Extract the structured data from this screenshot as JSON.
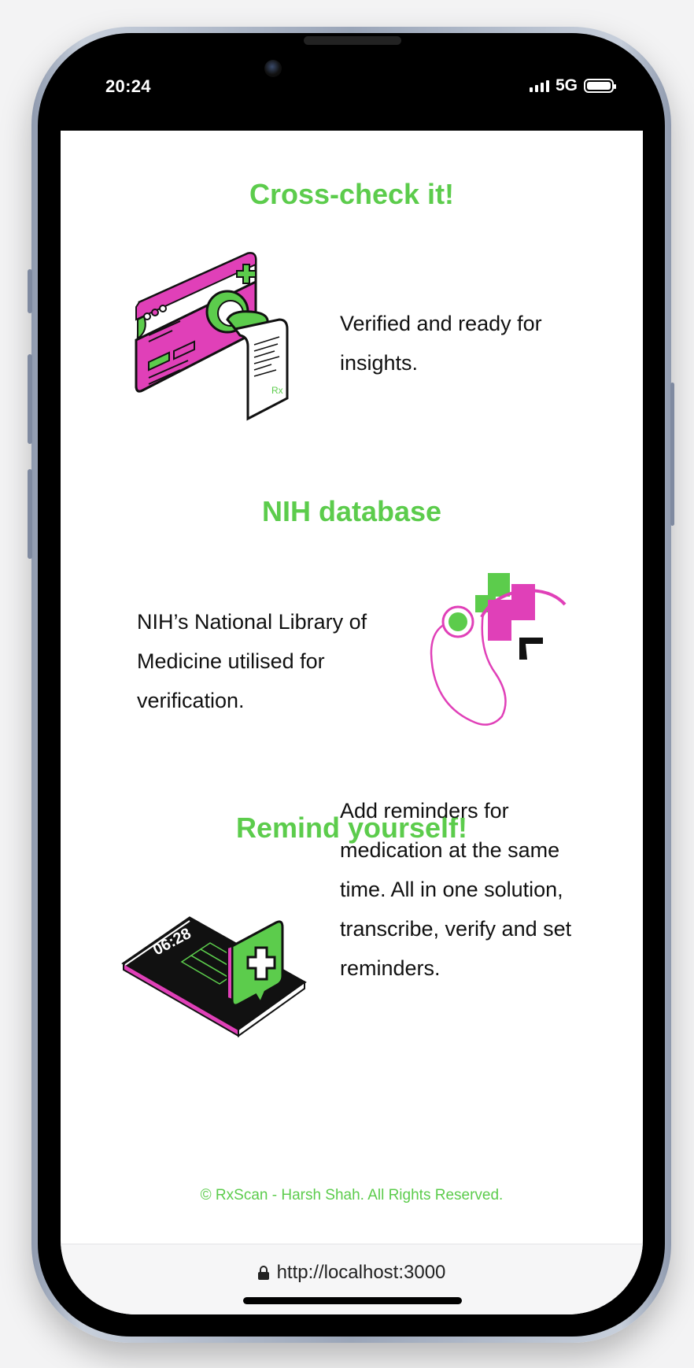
{
  "status_bar": {
    "time": "20:24",
    "network": "5G"
  },
  "sections": [
    {
      "title": "Cross-check it!",
      "text": "Verified and ready for insights."
    },
    {
      "title": "NIH database",
      "text": "NIH’s National Library of Medicine utilised for verification."
    },
    {
      "title": "Remind yourself!",
      "text": "Add reminders for medication at the same time. All in one solution, transcribe, verify and set reminders."
    }
  ],
  "illustrations": {
    "phone_clock": "06:28",
    "rx_mark": "Rx"
  },
  "footer": {
    "copyright": "© RxScan - Harsh Shah. All Rights Reserved."
  },
  "browser": {
    "url": "http://localhost:3000"
  },
  "colors": {
    "accent_green": "#5ccc4c",
    "accent_magenta": "#e040b8",
    "text": "#111111"
  }
}
